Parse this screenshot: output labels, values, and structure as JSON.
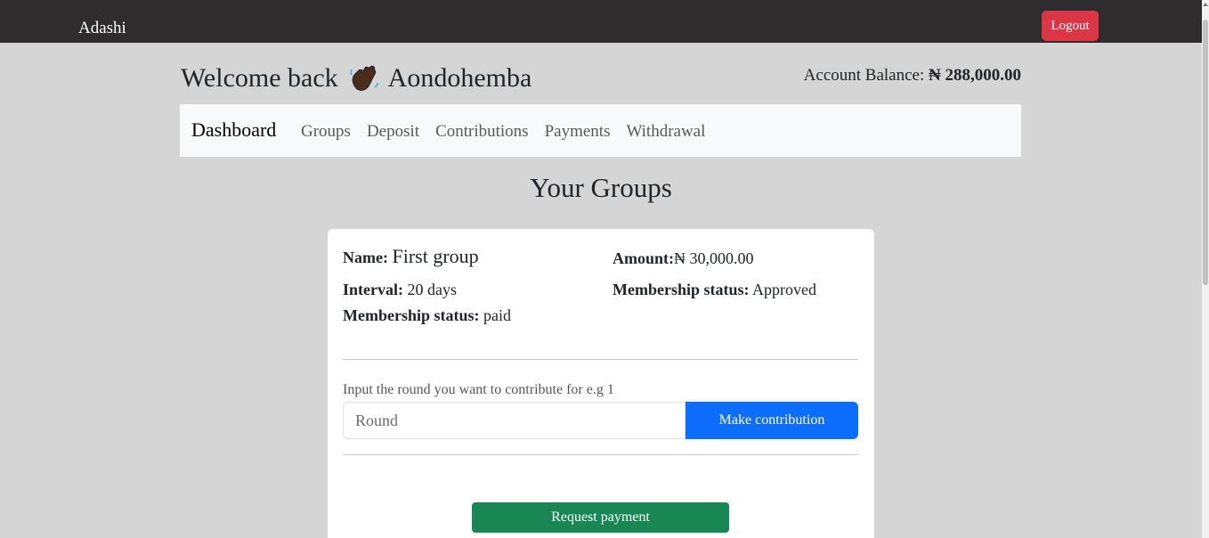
{
  "app": {
    "brand": "Adashi",
    "logout_label": "Logout"
  },
  "welcome": {
    "prefix": "Welcome back",
    "emoji": "👋",
    "name": "Aondohemba"
  },
  "account": {
    "label": "Account Balance:",
    "currency": "₦",
    "amount": "288,000.00"
  },
  "nav": {
    "dashboard": "Dashboard",
    "links": [
      "Groups",
      "Deposit",
      "Contributions",
      "Payments",
      "Withdrawal"
    ]
  },
  "page": {
    "heading": "Your Groups"
  },
  "group": {
    "name_label": "Name:",
    "name_value": "First group",
    "amount_label": "Amount:",
    "amount_value": "₦ 30,000.00",
    "interval_label": "Interval:",
    "interval_value": "20 days",
    "membership_label": "Membership status:",
    "membership_value_right": "Approved",
    "membership_value_left": "paid",
    "round_label": "Input the round you want to contribute for e.g 1",
    "round_placeholder": "Round",
    "contribute_label": "Make contribution",
    "request_label": "Request payment"
  },
  "colors": {
    "topbar": "#2f2c2d",
    "page_bg": "#d5d5d5",
    "logout": "#dc3545",
    "primary": "#0d6efd",
    "success": "#198754"
  }
}
